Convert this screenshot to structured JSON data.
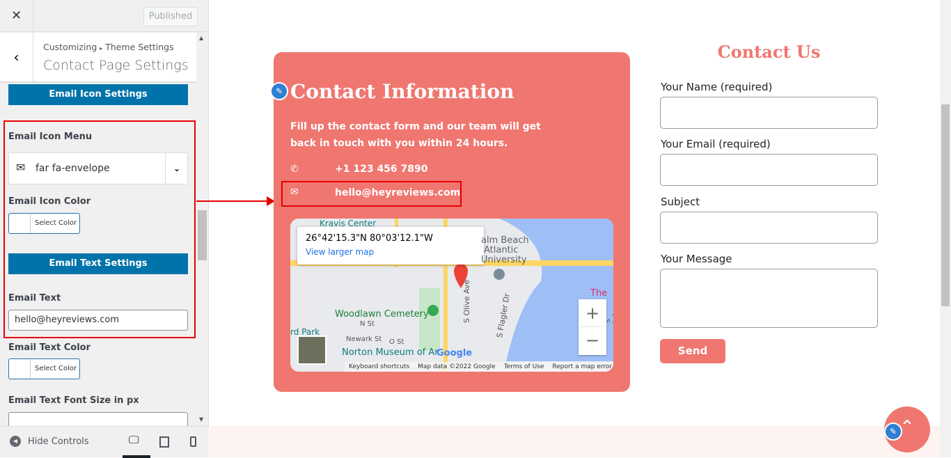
{
  "sidebar": {
    "close": "✕",
    "published": "Published",
    "back": "‹",
    "breadcrumb": {
      "root": "Customizing",
      "sep": "▸",
      "parent": "Theme Settings"
    },
    "title": "Contact Page Settings",
    "email_icon_settings": "Email Icon Settings",
    "email_icon_menu_label": "Email Icon Menu",
    "email_icon_value": "far fa-envelope",
    "email_icon_color_label": "Email Icon Color",
    "select_color": "Select Color",
    "email_text_settings": "Email Text Settings",
    "email_text_label": "Email Text",
    "email_text_value": "hello@heyreviews.com",
    "email_text_color_label": "Email Text Color",
    "email_font_size_label": "Email Text Font Size in px",
    "email_font_size_value": "",
    "hide_controls": "Hide Controls"
  },
  "card": {
    "title": "Contact Information",
    "description": "Fill up the contact form and our team will get back in touch with you within 24 hours.",
    "phone": "+1 123 456 7890",
    "email": "hello@heyreviews.com",
    "color": "#f07670"
  },
  "map": {
    "coords": "26°42'15.3\"N 80°03'12.1\"W",
    "view_larger": "View larger map",
    "labels": [
      "Kravis Center",
      "alm Beach",
      "Atlantic",
      "University",
      "Woodlawn Cemetery",
      "N St",
      "Newark St",
      "O St",
      "Norton Museum of Ar",
      "S Olive Ave",
      "S Flagler Dr",
      "The B",
      "rd Park",
      "S Lake Dr"
    ],
    "google": "Google",
    "footer": [
      "Keyboard shortcuts",
      "Map data ©2022 Google",
      "Terms of Use",
      "Report a map error"
    ],
    "zoom_in": "+",
    "zoom_out": "−"
  },
  "form": {
    "title": "Contact Us",
    "name_label": "Your Name (required)",
    "email_label": "Your Email (required)",
    "subject_label": "Subject",
    "message_label": "Your Message",
    "send": "Send"
  }
}
